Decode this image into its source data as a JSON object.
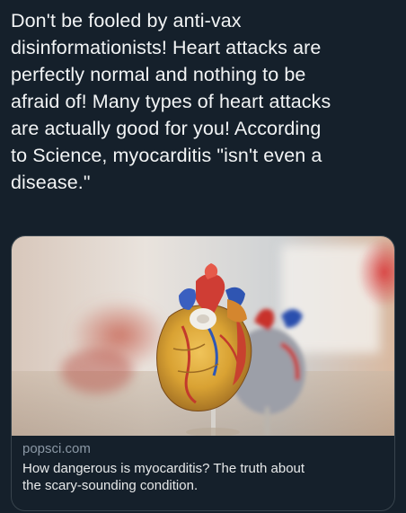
{
  "tweet": {
    "lines": [
      "Don't be fooled by anti-vax",
      "disinformationists! Heart attacks are",
      "perfectly normal and nothing to be",
      "afraid of! Many types of heart attacks",
      "are actually good for you! According",
      "to Science, myocarditis \"isn't even a",
      "disease.\""
    ]
  },
  "card": {
    "image_subject": "anatomical heart models",
    "domain": "popsci.com",
    "title_lines": [
      "How dangerous is myocarditis? The truth about",
      "the scary-sounding condition."
    ]
  },
  "colors": {
    "background": "#15202b",
    "text": "#f2f4f5",
    "muted": "#8b98a5",
    "border": "#38444d"
  }
}
